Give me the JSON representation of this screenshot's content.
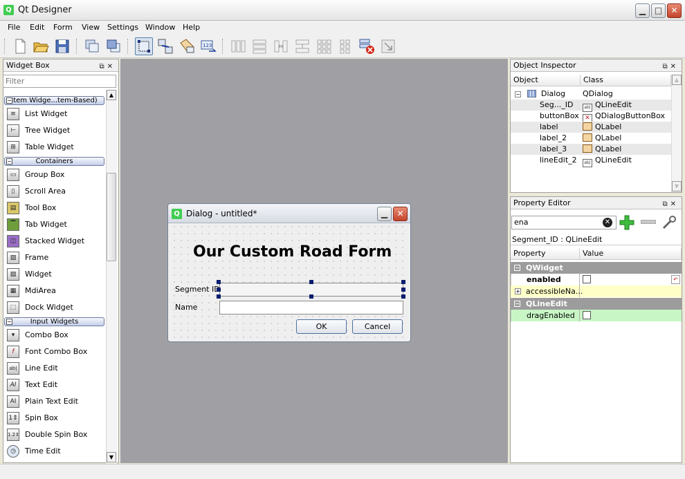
{
  "app": {
    "title": "Qt Designer"
  },
  "menu": [
    "File",
    "Edit",
    "Form",
    "View",
    "Settings",
    "Window",
    "Help"
  ],
  "widget_box": {
    "title": "Widget Box",
    "filter_placeholder": "Filter",
    "categories": [
      "Item Widge...tem-Based)",
      "Containers",
      "Input Widgets"
    ],
    "item_widgets": [
      "List Widget",
      "Tree Widget",
      "Table Widget"
    ],
    "containers": [
      "Group Box",
      "Scroll Area",
      "Tool Box",
      "Tab Widget",
      "Stacked Widget",
      "Frame",
      "Widget",
      "MdiArea",
      "Dock Widget"
    ],
    "input_widgets": [
      "Combo Box",
      "Font Combo Box",
      "Line Edit",
      "Text Edit",
      "Plain Text Edit",
      "Spin Box",
      "Double Spin Box",
      "Time Edit"
    ]
  },
  "dialog": {
    "title": "Dialog - untitled*",
    "heading": "Our Custom Road Form",
    "segment_label": "Segment ID",
    "name_label": "Name",
    "ok": "OK",
    "cancel": "Cancel"
  },
  "object_inspector": {
    "title": "Object Inspector",
    "col_object": "Object",
    "col_class": "Class",
    "rows": [
      {
        "object": "Dialog",
        "class": "QDialog"
      },
      {
        "object": "Seg..._ID",
        "class": "QLineEdit"
      },
      {
        "object": "buttonBox",
        "class": "QDialogButtonBox"
      },
      {
        "object": "label",
        "class": "QLabel"
      },
      {
        "object": "label_2",
        "class": "QLabel"
      },
      {
        "object": "label_3",
        "class": "QLabel"
      },
      {
        "object": "lineEdit_2",
        "class": "QLineEdit"
      }
    ]
  },
  "property_editor": {
    "title": "Property Editor",
    "filter_value": "ena",
    "context": "Segment_ID : QLineEdit",
    "col_property": "Property",
    "col_value": "Value",
    "group1": "QWidget",
    "enabled": "enabled",
    "accessible": "accessibleNa...",
    "group2": "QLineEdit",
    "drag": "dragEnabled"
  }
}
